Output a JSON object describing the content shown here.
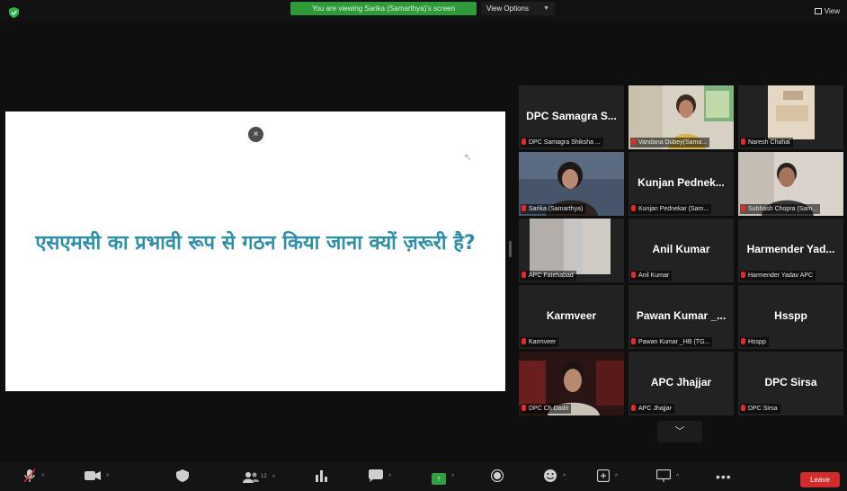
{
  "topbar": {
    "banner_text": "You are viewing Sarika (Samarthya)'s screen",
    "view_options_label": "View Options",
    "view_label": "View"
  },
  "slide": {
    "question": "एसएमसी का प्रभावी रूप से गठन किया जाना क्यों ज़रूरी है?",
    "close_glyph": "×"
  },
  "participants": [
    {
      "name": "DPC Samagra S...",
      "label": "DPC Samagra Shiksha ..."
    },
    {
      "name": "",
      "label": "Vandana Dubey(Sama..."
    },
    {
      "name": "",
      "label": "Naresh Chahal"
    },
    {
      "name": "",
      "label": "Sarika (Samarthya)"
    },
    {
      "name": "Kunjan Pednek...",
      "label": "Kunjan Pednekar (Sam..."
    },
    {
      "name": "",
      "label": "Subhash Chopra (Sam..."
    },
    {
      "name": "",
      "label": "APC Fatehabad"
    },
    {
      "name": "Anil Kumar",
      "label": "Anil Kumar"
    },
    {
      "name": "Harmender Yad...",
      "label": "Harmender Yadav APC"
    },
    {
      "name": "Karmveer",
      "label": "Karmveer"
    },
    {
      "name": "Pawan Kumar _...",
      "label": "Pawan Kumar _HB (TG..."
    },
    {
      "name": "Hsspp",
      "label": "Hsspp"
    },
    {
      "name": "",
      "label": "DPC Ch Dadri"
    },
    {
      "name": "APC Jhajjar",
      "label": "APC Jhajjar"
    },
    {
      "name": "DPC Sirsa",
      "label": "DPC Sirsa"
    }
  ],
  "toolbar": {
    "participants_count": "12",
    "leave_label": "Leave"
  },
  "colors": {
    "slide_text": "#2f8fa6",
    "banner_green": "#2e9a3a",
    "leave_red": "#d22b2b",
    "active_speaker": "#c8e04a"
  }
}
